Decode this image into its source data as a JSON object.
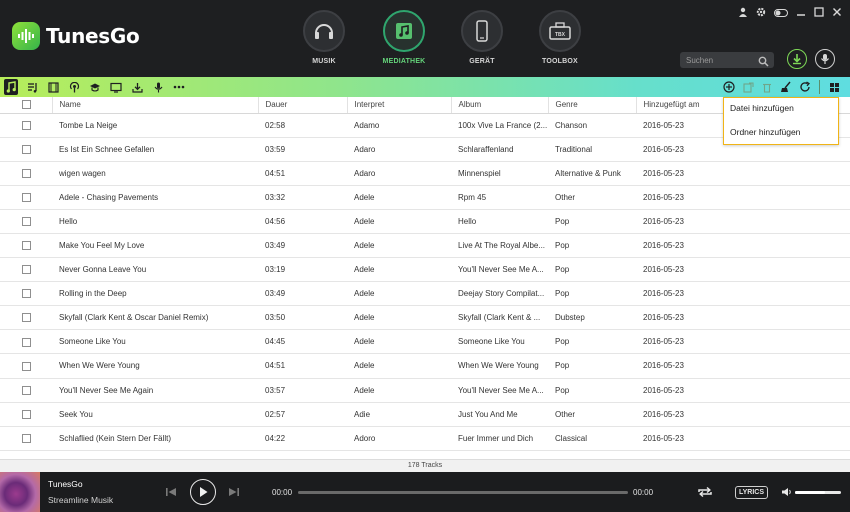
{
  "app": {
    "name": "TunesGo"
  },
  "nav": {
    "items": [
      {
        "label": "MUSIK",
        "icon": "headphones-icon",
        "active": false
      },
      {
        "label": "MEDIATHEK",
        "icon": "library-icon",
        "active": true
      },
      {
        "label": "GERÄT",
        "icon": "phone-icon",
        "active": false
      },
      {
        "label": "TOOLBOX",
        "icon": "toolbox-icon",
        "active": false
      }
    ],
    "toolbox_badge": "TBX"
  },
  "window_controls": [
    "user-icon",
    "settings-icon",
    "toggle-icon",
    "minimize-icon",
    "maximize-icon",
    "close-icon"
  ],
  "search": {
    "placeholder": "Suchen"
  },
  "toolbar": {
    "left_icons": [
      "music-icon",
      "playlist-icon",
      "video-icon",
      "podcast-icon",
      "itunes-u-icon",
      "tv-icon",
      "download-icon",
      "voice-memo-icon",
      "more-icon"
    ],
    "right_icons": [
      "add-icon",
      "export-icon",
      "delete-icon",
      "clean-icon",
      "refresh-icon",
      "grid-view-icon"
    ]
  },
  "table": {
    "columns": [
      "Name",
      "Dauer",
      "Interpret",
      "Album",
      "Genre",
      "Hinzugefügt am"
    ],
    "rows": [
      [
        "Tombe La Neige",
        "02:58",
        "Adamo",
        "100x Vive La France (2...",
        "Chanson",
        "2016-05-23"
      ],
      [
        "Es Ist Ein Schnee Gefallen",
        "03:59",
        "Adaro",
        "Schlaraffenland",
        "Traditional",
        "2016-05-23"
      ],
      [
        "wigen wagen",
        "04:51",
        "Adaro",
        "Minnenspiel",
        "Alternative & Punk",
        "2016-05-23"
      ],
      [
        "Adele - Chasing Pavements",
        "03:32",
        "Adele",
        "Rpm 45",
        "Other",
        "2016-05-23"
      ],
      [
        "Hello",
        "04:56",
        "Adele",
        "Hello",
        "Pop",
        "2016-05-23"
      ],
      [
        "Make You Feel My Love",
        "03:49",
        "Adele",
        "Live At The Royal Albe...",
        "Pop",
        "2016-05-23"
      ],
      [
        "Never Gonna Leave You",
        "03:19",
        "Adele",
        "You'll Never See Me A...",
        "Pop",
        "2016-05-23"
      ],
      [
        "Rolling in the Deep",
        "03:49",
        "Adele",
        "Deejay Story Compilat...",
        "Pop",
        "2016-05-23"
      ],
      [
        "Skyfall (Clark Kent & Oscar Daniel Remix)",
        "03:50",
        "Adele",
        "Skyfall (Clark Kent & ...",
        "Dubstep",
        "2016-05-23"
      ],
      [
        "Someone Like You",
        "04:45",
        "Adele",
        "Someone Like You",
        "Pop",
        "2016-05-23"
      ],
      [
        "When We Were Young",
        "04:51",
        "Adele",
        "When We Were Young",
        "Pop",
        "2016-05-23"
      ],
      [
        "You'll Never See Me Again",
        "03:57",
        "Adele",
        "You'll Never See Me A...",
        "Pop",
        "2016-05-23"
      ],
      [
        "Seek You",
        "02:57",
        "Adie",
        "Just You And Me",
        "Other",
        "2016-05-23"
      ],
      [
        "Schlaflied (Kein Stern Der Fällt)",
        "04:22",
        "Adoro",
        "Fuer Immer und Dich",
        "Classical",
        "2016-05-23"
      ]
    ]
  },
  "dropdown": {
    "items": [
      "Datei hinzufügen",
      "Ordner hinzufügen"
    ]
  },
  "status": {
    "tracks": "178 Tracks"
  },
  "player": {
    "title": "TunesGo",
    "artist": "Streamline Musik",
    "time_current": "00:00",
    "time_total": "00:00",
    "progress": 0,
    "lyrics_label": "LYRICS",
    "volume": 0.65
  },
  "colors": {
    "header_bg": "#1e1f21",
    "accent_green": "#64d37a",
    "dropdown_border": "#f0b417",
    "toolbar_start": "#b7ed5a",
    "toolbar_end": "#5fdde0"
  }
}
